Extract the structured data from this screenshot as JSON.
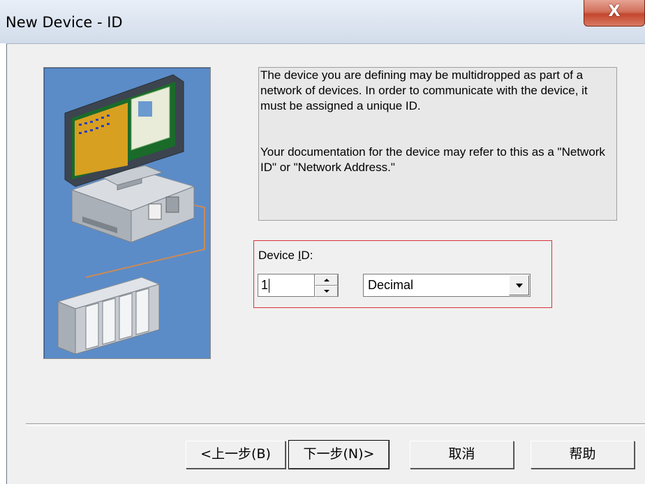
{
  "window": {
    "title": "New Device - ID",
    "close_label": "X"
  },
  "info": {
    "paragraph1": "The device you are defining may be multidropped as part of a network of devices.  In order to communicate with the device, it must be assigned a unique ID.",
    "paragraph2": "Your documentation for the device may refer to this as a \"Network ID\" or \"Network Address.\""
  },
  "device_id": {
    "label_prefix": "Device ",
    "label_mnemonic": "I",
    "label_suffix": "D:",
    "value": "1",
    "format_selected": "Decimal"
  },
  "buttons": {
    "back": "<上一步(B)",
    "next": "下一步(N)>",
    "cancel": "取消",
    "help": "帮助"
  },
  "icons": [
    "close-icon",
    "spin-up-icon",
    "spin-down-icon",
    "chevron-down-icon",
    "computer-plc-illustration"
  ]
}
